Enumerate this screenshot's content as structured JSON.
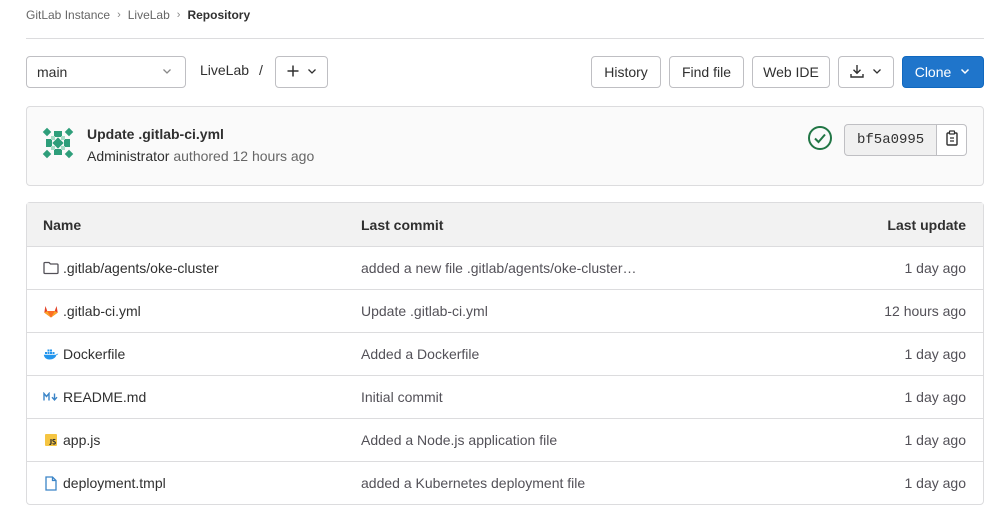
{
  "breadcrumb": {
    "items": [
      "GitLab Instance",
      "LiveLab"
    ],
    "current": "Repository"
  },
  "toolbar": {
    "branch": "main",
    "path": "LiveLab",
    "path_sep": "/",
    "history": "History",
    "find_file": "Find file",
    "web_ide": "Web IDE",
    "clone": "Clone"
  },
  "last_commit": {
    "title": "Update .gitlab-ci.yml",
    "author": "Administrator",
    "meta": "authored 12 hours ago",
    "sha": "bf5a0995",
    "status": "passed",
    "status_color": "#217645"
  },
  "table": {
    "headers": {
      "name": "Name",
      "last_commit": "Last commit",
      "last_update": "Last update"
    },
    "rows": [
      {
        "icon": "folder-icon",
        "name": ".gitlab/agents/oke-cluster",
        "commit": "added a new file .gitlab/agents/oke-cluster…",
        "updated": "1 day ago"
      },
      {
        "icon": "gitlab-icon",
        "name": ".gitlab-ci.yml",
        "commit": "Update .gitlab-ci.yml",
        "updated": "12 hours ago"
      },
      {
        "icon": "docker-icon",
        "name": "Dockerfile",
        "commit": "Added a Dockerfile",
        "updated": "1 day ago"
      },
      {
        "icon": "markdown-icon",
        "name": "README.md",
        "commit": "Initial commit",
        "updated": "1 day ago"
      },
      {
        "icon": "javascript-icon",
        "name": "app.js",
        "commit": "Added a Node.js application file",
        "updated": "1 day ago"
      },
      {
        "icon": "file-icon",
        "name": "deployment.tmpl",
        "commit": "added a Kubernetes deployment file",
        "updated": "1 day ago"
      }
    ]
  },
  "colors": {
    "accent": "#1f75cb",
    "border": "#dcdcde",
    "success": "#217645"
  }
}
